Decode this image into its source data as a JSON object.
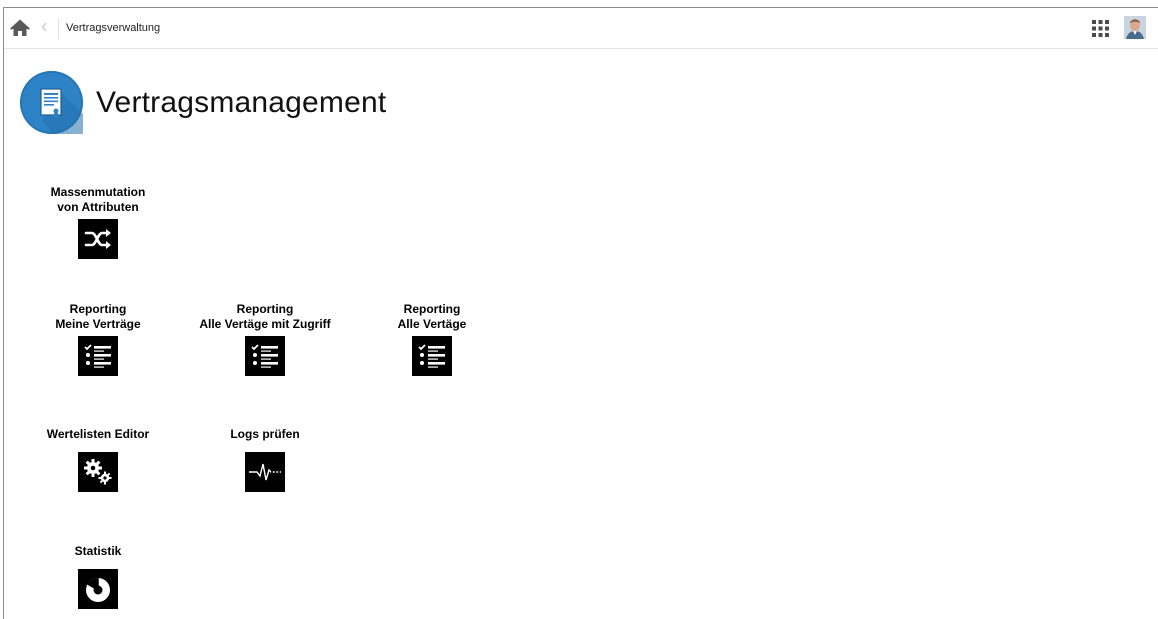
{
  "topbar": {
    "breadcrumb": "Vertragsverwaltung",
    "home_icon": "home-icon",
    "back_icon": "chevron-left-icon",
    "apps_icon": "grid-icon"
  },
  "header": {
    "title": "Vertragsmanagement",
    "icon": "contract-document-icon",
    "icon_color": "#2e83c7"
  },
  "tiles": [
    {
      "label": "Massenmutation\nvon Attributen",
      "icon": "shuffle-icon"
    },
    {
      "label": "Reporting\nMeine Verträge",
      "icon": "checklist-icon"
    },
    {
      "label": "Reporting\nAlle Vertäge mit Zugriff",
      "icon": "checklist-icon"
    },
    {
      "label": "Reporting\nAlle Vertäge",
      "icon": "checklist-icon"
    },
    {
      "label": "Wertelisten Editor",
      "icon": "gears-icon"
    },
    {
      "label": "Logs prüfen",
      "icon": "pulse-icon"
    },
    {
      "label": "Statistik",
      "icon": "pie-chart-icon"
    }
  ]
}
